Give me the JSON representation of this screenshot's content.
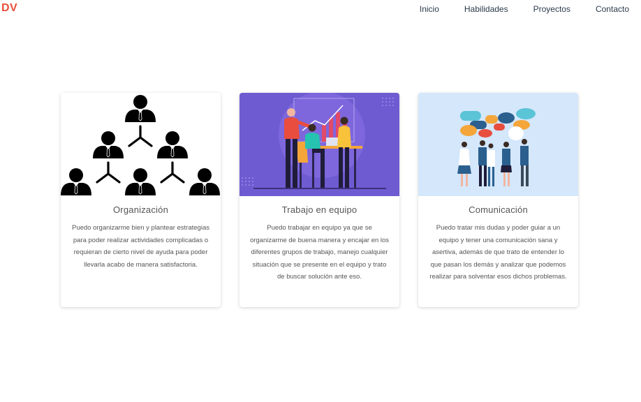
{
  "logo": "DV",
  "nav": {
    "items": [
      {
        "label": "Inicio"
      },
      {
        "label": "Habilidades"
      },
      {
        "label": "Proyectos"
      },
      {
        "label": "Contacto"
      }
    ]
  },
  "cards": [
    {
      "title": "Organización",
      "text": "Puedo organizarme bien y plantear estrategias para poder realizar actividades complicadas o requieran de cierto nivel de ayuda para poder llevarla acabo de manera satisfactoria.",
      "image": "organization-chart-illustration"
    },
    {
      "title": "Trabajo en equipo",
      "text": "Puedo trabajar en equipo ya que se organizarme de buena manera y encajar en los diferentes grupos de trabajo, manejo cualquier situación que se presente en el equipo y trato de buscar solución ante eso.",
      "image": "teamwork-illustration",
      "bg_color": "#6f5bd1"
    },
    {
      "title": "Comunicación",
      "text": "Puedo tratar mis dudas y poder guiar a un equipo y tener una comunicación sana y asertiva, además de que trato de entender lo que pasan los demás y analizar que podemos realizar para solventar esos dichos problemas.",
      "image": "communication-illustration",
      "bg_color": "#d4e7fb"
    }
  ]
}
